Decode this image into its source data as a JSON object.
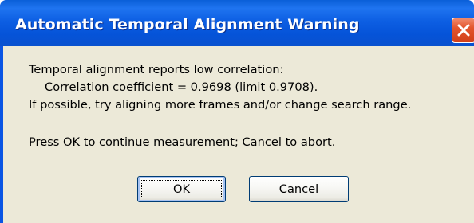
{
  "dialog": {
    "title": "Automatic Temporal Alignment Warning",
    "close_icon": "close-icon",
    "message_lines": [
      "Temporal alignment reports low correlation:",
      "Correlation coefficient = 0.9698 (limit 0.9708).",
      "If possible, try aligning more frames and/or change search range.",
      "Press OK to continue measurement; Cancel to abort."
    ],
    "ok_label": "OK",
    "cancel_label": "Cancel"
  },
  "colors": {
    "titlebar": "#0553d8",
    "client_background": "#ece9d8",
    "close_button": "#e3552e",
    "button_border": "#003c74"
  }
}
